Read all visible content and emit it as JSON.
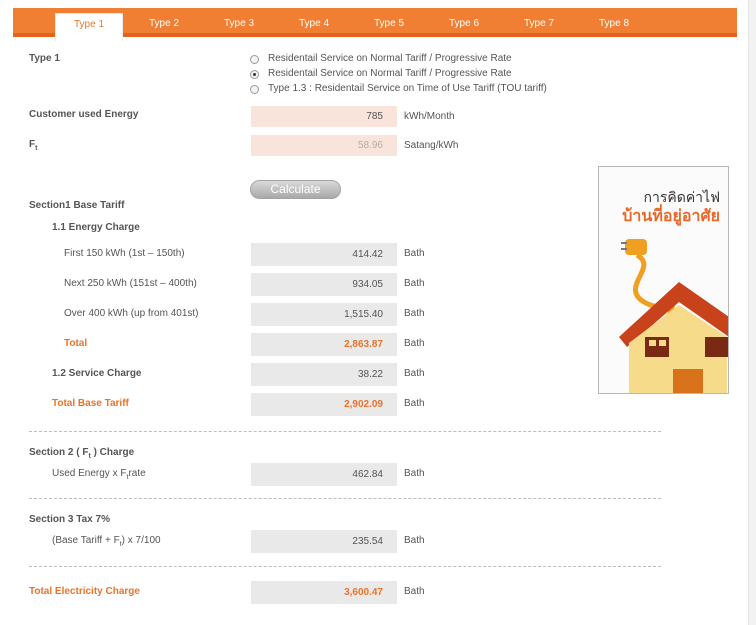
{
  "tabs": [
    "Type 1",
    "Type 2",
    "Type 3",
    "Type 4",
    "Type 5",
    "Type 6",
    "Type 7",
    "Type 8"
  ],
  "type_section": {
    "label": "Type 1",
    "options": [
      {
        "label": "Residentail Service on Normal Tariff / Progressive Rate",
        "selected": false
      },
      {
        "label": "Residentail Service on Normal Tariff / Progressive Rate",
        "selected": true
      },
      {
        "label": "Type 1.3 : Residentail Service on Time of Use Tariff (TOU tariff)",
        "selected": false
      }
    ]
  },
  "inputs": {
    "energy_label": "Customer used Energy",
    "energy_value": "785",
    "energy_unit": "kWh/Month",
    "ft_label_main": "F",
    "ft_label_sub": "t",
    "ft_value": "58.96",
    "ft_unit": "Satang/kWh"
  },
  "calculate_button": "Calculate",
  "section1": {
    "title": "Section1 Base Tariff",
    "energy_charge_title": "1.1 Energy Charge",
    "rows": [
      {
        "label": "First 150 kWh (1st – 150th)",
        "value": "414.42",
        "unit": "Bath"
      },
      {
        "label": "Next 250 kWh (151st – 400th)",
        "value": "934.05",
        "unit": "Bath"
      },
      {
        "label": "Over 400 kWh (up from 401st)",
        "value": "1,515.40",
        "unit": "Bath"
      }
    ],
    "total_label": "Total",
    "total_value": "2,863.87",
    "total_unit": "Bath",
    "service_label": "1.2 Service Charge",
    "service_value": "38.22",
    "service_unit": "Bath",
    "base_total_label": "Total Base Tariff",
    "base_total_value": "2,902.09",
    "base_total_unit": "Bath"
  },
  "section2": {
    "title_pre": "Section 2 ( F",
    "title_sub": "t",
    "title_post": " ) Charge",
    "row_label_pre": "Used Energy x F",
    "row_label_sub": "t",
    "row_label_post": "rate",
    "value": "462.84",
    "unit": "Bath"
  },
  "section3": {
    "title": "Section 3 Tax 7%",
    "row_label_pre": "(Base Tariff + F",
    "row_label_sub": "t",
    "row_label_post": ") x 7/100",
    "value": "235.54",
    "unit": "Bath"
  },
  "total": {
    "label": "Total Electricity Charge",
    "value": "3,600.47",
    "unit": "Bath"
  },
  "banner": {
    "line1": "การคิดค่าไฟ",
    "line2": "บ้านที่อยู่อาศัย"
  },
  "colors": {
    "accent": "#f07f34",
    "accent_text": "#e8742a",
    "input_bg": "#f8e4da",
    "value_bg": "#e9e9e9"
  }
}
